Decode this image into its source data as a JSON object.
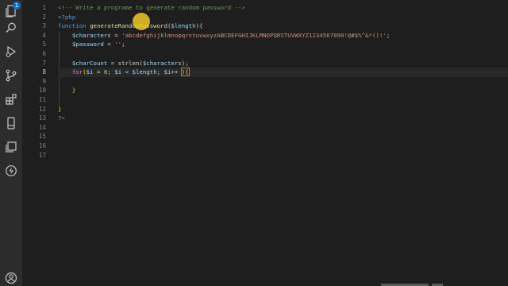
{
  "activity_bar": {
    "icons": [
      "explorer-icon",
      "search-icon",
      "run-debug-icon",
      "source-control-icon",
      "extensions-icon",
      "mobile-icon",
      "copy-icon",
      "lightning-icon",
      "account-icon"
    ],
    "explorer_badge": "1"
  },
  "editor": {
    "line_numbers": [
      "1",
      "2",
      "3",
      "4",
      "5",
      "6",
      "7",
      "8",
      "9",
      "10",
      "11",
      "12",
      "13",
      "14",
      "15",
      "16",
      "17"
    ],
    "active_line": 8,
    "colors": {
      "comment": "#6a9955",
      "keyword": "#569cd6",
      "function": "#dcdcaa",
      "variable": "#9cdcfe",
      "string": "#ce9178",
      "number": "#b5cea8",
      "control": "#c586c0",
      "punctuation": "#d4d4d4"
    },
    "lines": {
      "l1": "<!-- Write a programe to generate random password -->",
      "l2": "<?php",
      "l3_kw": "function",
      "l3_fn": "generateRandomPassword",
      "l3_p1": "(",
      "l3_var": "$length",
      "l3_p2": "){",
      "l4_var": "$characters",
      "l4_eq": " = ",
      "l4_str": "'abcdefghijklmnopqrstuvwxyzABCDEFGHIJKLMNOPQRSTUVWXYZ1234567890!@#$%^&*()!'",
      "l4_end": ";",
      "l5_var": "$password",
      "l5_eq": " = ",
      "l5_str": "''",
      "l5_end": ";",
      "l7_var": "$charCount",
      "l7_eq": " = ",
      "l7_fn": "strlen",
      "l7_p1": "(",
      "l7_arg": "$characters",
      "l7_p2": ");",
      "l8_kw": "for",
      "l8_p1": "(",
      "l8_v1": "$i",
      "l8_eq": " = ",
      "l8_n": "0",
      "l8_s1": "; ",
      "l8_v2": "$i",
      "l8_lt": " < ",
      "l8_v3": "$length",
      "l8_s2": "; ",
      "l8_v4": "$i",
      "l8_inc": "++ ",
      "l8_p2": "){",
      "l10": "}",
      "l12": "}",
      "l13": "?>"
    }
  }
}
